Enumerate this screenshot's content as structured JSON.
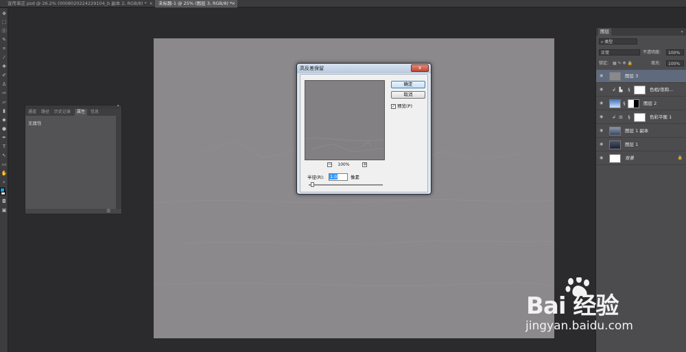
{
  "tabs": [
    {
      "label": "宣传单正.psd @ 26.2% (0008020224229104_b 副本 2, RGB/8) *",
      "close": "×",
      "active": false
    },
    {
      "label": "未标题-1 @ 25% (图层 3, RGB/8) *",
      "close": "×",
      "active": true
    }
  ],
  "properties_panel": {
    "tabs": [
      "通道",
      "路径",
      "历史记录",
      "属性",
      "信息"
    ],
    "active_tab": "属性",
    "collapse_glyph": "»",
    "body_text": "无属性"
  },
  "layers_panel": {
    "title": "图层",
    "collapse_glyph": "»",
    "filter_kind": "类型",
    "blend_mode": "正常",
    "opacity_label": "不透明度:",
    "opacity_value": "100%",
    "lock_label": "锁定:",
    "fill_label": "填充:",
    "fill_value": "100%",
    "layers": [
      {
        "name": "图层 3",
        "selected": true,
        "thumb": "#8a898c"
      },
      {
        "name": "色相/饱和...",
        "selected": false,
        "adjustment": true
      },
      {
        "name": "图层 2",
        "selected": false,
        "thumb": "#5f86c7"
      },
      {
        "name": "色彩平衡 1",
        "selected": false,
        "adjustment": true
      },
      {
        "name": "图层 1 副本",
        "selected": false,
        "thumb": "#6b7890"
      },
      {
        "name": "图层 1",
        "selected": false,
        "thumb": "#2f3548"
      },
      {
        "name": "背景",
        "selected": false,
        "thumb": "#ffffff",
        "locked": true
      }
    ]
  },
  "dialog": {
    "title": "高反差保留",
    "close_glyph": "x",
    "ok_label": "确定",
    "cancel_label": "取消",
    "preview_label": "预览(P)",
    "preview_checked": true,
    "zoom_value": "100%",
    "zoom_out": "−",
    "zoom_in": "+",
    "radius_label": "半径(R):",
    "radius_value": "1.0",
    "radius_unit": "像素",
    "slider_fraction": 0.03
  },
  "watermark": {
    "logo_text": "Bai  经验",
    "url": "jingyan.baidu.com"
  },
  "colors": {
    "foreground": "#1a9fe0",
    "background": "#ffffff"
  }
}
